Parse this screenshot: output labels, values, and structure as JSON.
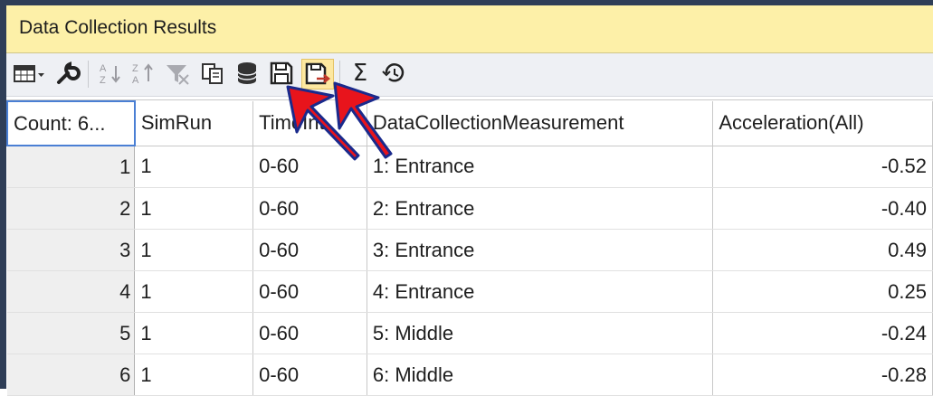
{
  "window": {
    "title": "Data Collection Results"
  },
  "toolbar": {
    "icons": [
      "grid-menu-icon",
      "wrench-icon",
      "sort-ascending-icon",
      "sort-descending-icon",
      "filter-icon",
      "copy-icon",
      "database-icon",
      "save-icon",
      "save-export-icon",
      "sum-icon",
      "history-icon"
    ],
    "sum_glyph": "Σ"
  },
  "table": {
    "columns": [
      "Count: 6...",
      "SimRun",
      "TimeInt",
      "DataCollectionMeasurement",
      "Acceleration(All)"
    ],
    "rows": [
      {
        "count": "1",
        "simrun": "1",
        "timeint": "0-60",
        "measurement": "1: Entrance",
        "acceleration": "-0.52"
      },
      {
        "count": "2",
        "simrun": "1",
        "timeint": "0-60",
        "measurement": "2: Entrance",
        "acceleration": "-0.40"
      },
      {
        "count": "3",
        "simrun": "1",
        "timeint": "0-60",
        "measurement": "3: Entrance",
        "acceleration": "0.49"
      },
      {
        "count": "4",
        "simrun": "1",
        "timeint": "0-60",
        "measurement": "4: Entrance",
        "acceleration": "0.25"
      },
      {
        "count": "5",
        "simrun": "1",
        "timeint": "0-60",
        "measurement": "5: Middle",
        "acceleration": "-0.24"
      },
      {
        "count": "6",
        "simrun": "1",
        "timeint": "0-60",
        "measurement": "6: Middle",
        "acceleration": "-0.28"
      }
    ]
  },
  "colors": {
    "title_bg": "#fdf0a8",
    "frame_border": "#2f3e57",
    "annotation_arrow": "#e8141c"
  }
}
